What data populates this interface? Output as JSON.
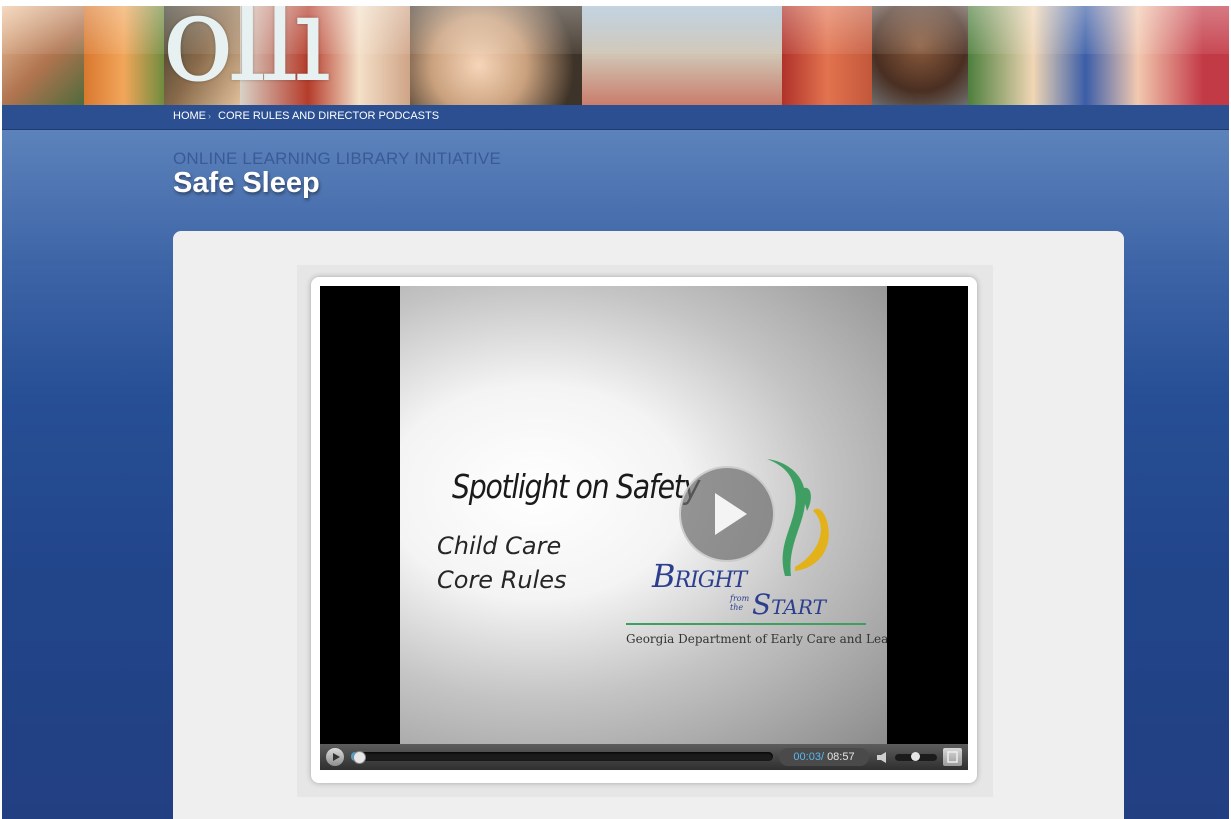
{
  "header": {
    "logo_text": "olli",
    "nav": {
      "home": "HOME",
      "separator": "›",
      "current": "CORE RULES AND DIRECTOR PODCASTS"
    }
  },
  "page": {
    "subtitle": "ONLINE LEARNING LIBRARY INITIATIVE",
    "title": "Safe Sleep"
  },
  "video": {
    "slide": {
      "headline": "Spotlight on Safety",
      "line1": "Child Care",
      "line2": "Core Rules",
      "brand_bright": "Bright",
      "brand_from_the": "from the",
      "brand_start": "Start",
      "department": "Georgia Department of Early Care and Learning"
    },
    "controls": {
      "current_time": "00:03",
      "time_separator": "/",
      "duration": "08:57",
      "progress_fraction": 0.006,
      "volume_fraction": 0.5
    }
  },
  "colors": {
    "nav_bar": "#2b4f90",
    "subtitle": "#3a5a95",
    "time_accent": "#5ab6ee",
    "brand_blue": "#2c3f8e",
    "brand_green": "#3f9f62"
  },
  "icons": {
    "big_play": "play-icon",
    "small_play": "play-icon",
    "volume": "speaker-icon",
    "fullscreen": "fullscreen-icon"
  }
}
